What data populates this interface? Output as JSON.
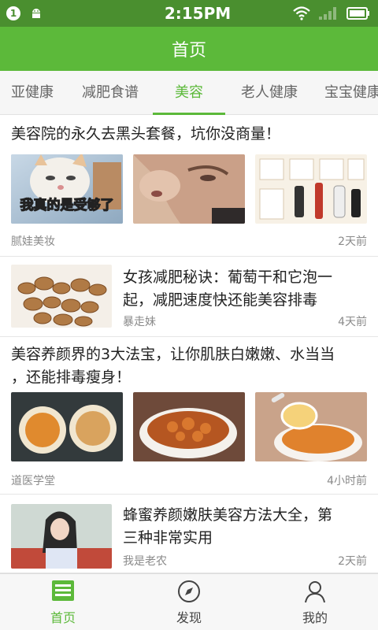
{
  "status_bar": {
    "notification_count": "1",
    "time": "2:15PM"
  },
  "app_bar": {
    "title": "首页"
  },
  "tabs": [
    {
      "label": "亚健康"
    },
    {
      "label": "减肥食谱"
    },
    {
      "label": "美容"
    },
    {
      "label": "老人健康"
    },
    {
      "label": "宝宝健康"
    }
  ],
  "active_tab": "美容",
  "feed": [
    {
      "title": "美容院的永久去黑头套餐，坑你没商量！",
      "source": "腻娃美妆",
      "time": "2天前",
      "images": [
        "cat-meme-image",
        "face-blackhead-image",
        "beauty-tips-chart-image"
      ],
      "image_text": "我真的是受够了"
    },
    {
      "title_lines": [
        "女孩减肥秘诀：葡萄干和它泡一",
        "起，减肥速度快还能美容排毒"
      ],
      "source": "暴走妹",
      "time": "4天前",
      "images": [
        "raisins-image"
      ]
    },
    {
      "title_lines": [
        "美容养颜界的3大法宝，让你肌肤白嫩嫩、水当当",
        "，还能排毒瘦身！"
      ],
      "source": "道医学堂",
      "time": "4小时前",
      "images": [
        "bird-nest-bowls-image",
        "peach-gum-bowl-image",
        "dessert-spoon-image"
      ]
    },
    {
      "title_lines": [
        "蜂蜜养颜嫩肤美容方法大全，第",
        "三种非常实用"
      ],
      "source": "我是老农",
      "time": "2天前",
      "images": [
        "girl-portrait-image"
      ]
    }
  ],
  "bottom_nav": [
    {
      "label": "首页",
      "icon": "news-icon",
      "active": true
    },
    {
      "label": "发现",
      "icon": "compass-icon",
      "active": false
    },
    {
      "label": "我的",
      "icon": "user-icon",
      "active": false
    }
  ],
  "colors": {
    "brand_green": "#5cb93a",
    "status_green": "#4a8f2f"
  }
}
